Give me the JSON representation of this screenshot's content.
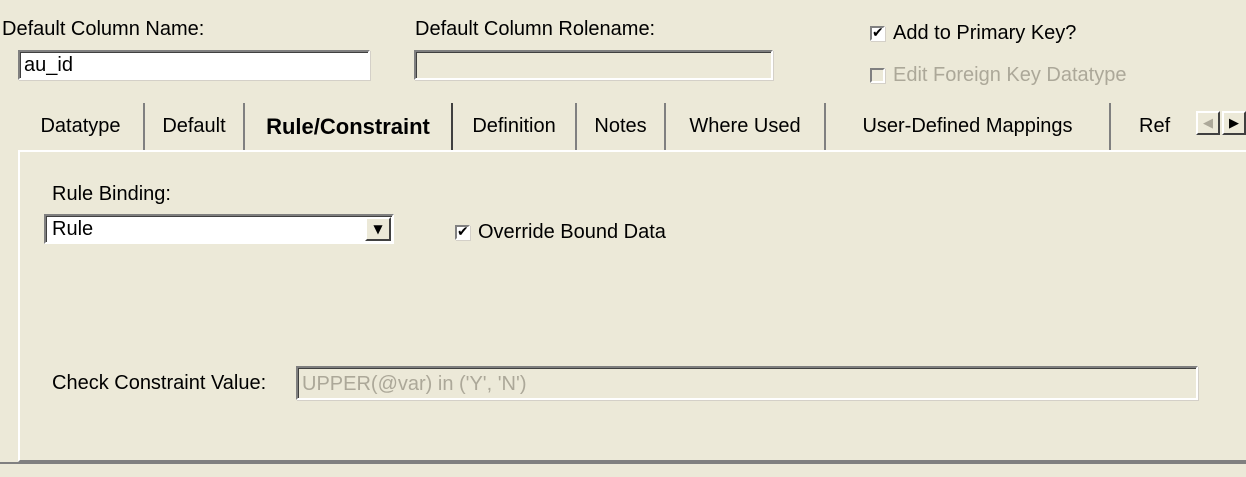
{
  "header": {
    "column_name_label": "Default Column Name:",
    "column_name_value": "au_id",
    "rolename_label": "Default Column Rolename:",
    "rolename_value": "",
    "add_to_pk_label": "Add to Primary Key?",
    "add_to_pk_checked": true,
    "edit_fk_label": "Edit Foreign Key Datatype",
    "edit_fk_checked": false
  },
  "tabs": [
    {
      "label": "Datatype",
      "active": false
    },
    {
      "label": "Default",
      "active": false
    },
    {
      "label": "Rule/Constraint",
      "active": true
    },
    {
      "label": "Definition",
      "active": false
    },
    {
      "label": "Notes",
      "active": false
    },
    {
      "label": "Where Used",
      "active": false
    },
    {
      "label": "User-Defined Mappings",
      "active": false
    },
    {
      "label": "Ref",
      "active": false
    }
  ],
  "panel": {
    "rule_binding_label": "Rule Binding:",
    "rule_binding_value": "Rule",
    "override_label": "Override Bound Data",
    "override_checked": true,
    "check_constraint_label": "Check Constraint Value:",
    "check_constraint_value": "UPPER(@var) in ('Y', 'N')"
  },
  "icons": {
    "check": "checkmark-icon",
    "dropdown": "chevron-down-icon",
    "scroll_left": "scroll-left-icon",
    "scroll_right": "scroll-right-icon"
  },
  "colors": {
    "background": "#ece9d8",
    "disabled_text": "#aca899"
  }
}
